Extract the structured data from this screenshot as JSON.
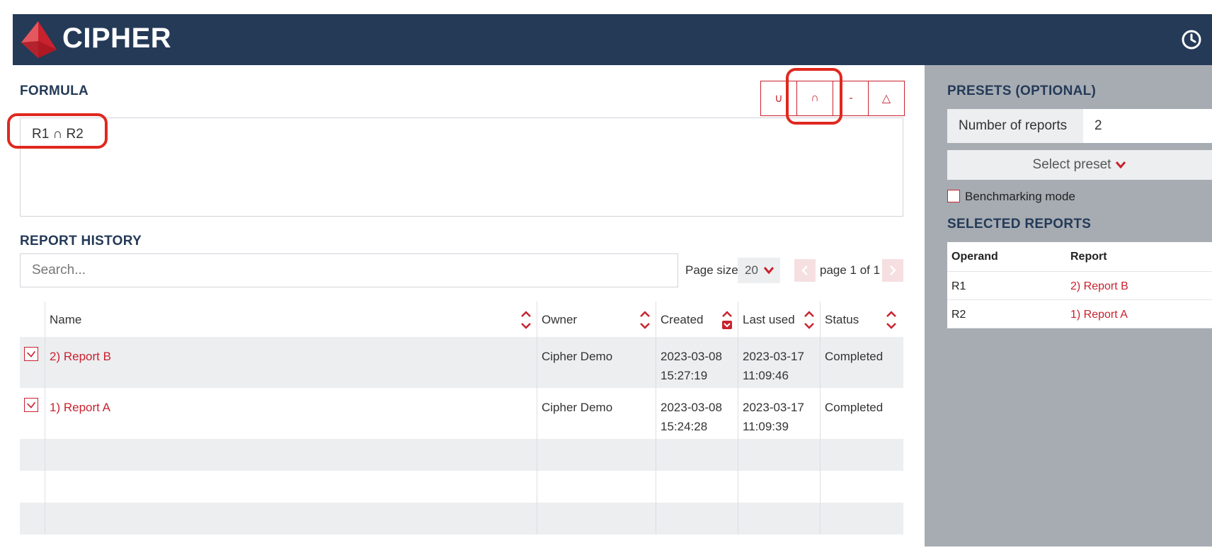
{
  "app": {
    "brand": "CIPHER"
  },
  "formula": {
    "title": "FORMULA",
    "value": "R1 ∩ R2",
    "operators": [
      "∪",
      "∩",
      "-",
      "△"
    ]
  },
  "history": {
    "title": "REPORT HISTORY",
    "search_placeholder": "Search...",
    "page_size_label": "Page size",
    "page_size_value": "20",
    "page_text": "page 1 of 1",
    "columns": [
      "Name",
      "Owner",
      "Created",
      "Last used",
      "Status"
    ],
    "rows": [
      {
        "name": "2) Report B",
        "owner": "Cipher Demo",
        "created_date": "2023-03-08",
        "created_time": "15:27:19",
        "last_date": "2023-03-17",
        "last_time": "11:09:46",
        "status": "Completed"
      },
      {
        "name": "1) Report A",
        "owner": "Cipher Demo",
        "created_date": "2023-03-08",
        "created_time": "15:24:28",
        "last_date": "2023-03-17",
        "last_time": "11:09:39",
        "status": "Completed"
      }
    ]
  },
  "presets": {
    "title": "PRESETS (OPTIONAL)",
    "number_label": "Number of reports",
    "number_value": "2",
    "select_label": "Select preset",
    "benchmark_label": "Benchmarking mode"
  },
  "selected": {
    "title": "SELECTED REPORTS",
    "columns": [
      "Operand",
      "Report"
    ],
    "rows": [
      {
        "operand": "R1",
        "report": "2) Report B"
      },
      {
        "operand": "R2",
        "report": "1) Report A"
      }
    ]
  },
  "colors": {
    "header": "#243a57",
    "accent": "#c9222f",
    "highlight": "#e0281f",
    "sidebar": "#a7acb3"
  }
}
